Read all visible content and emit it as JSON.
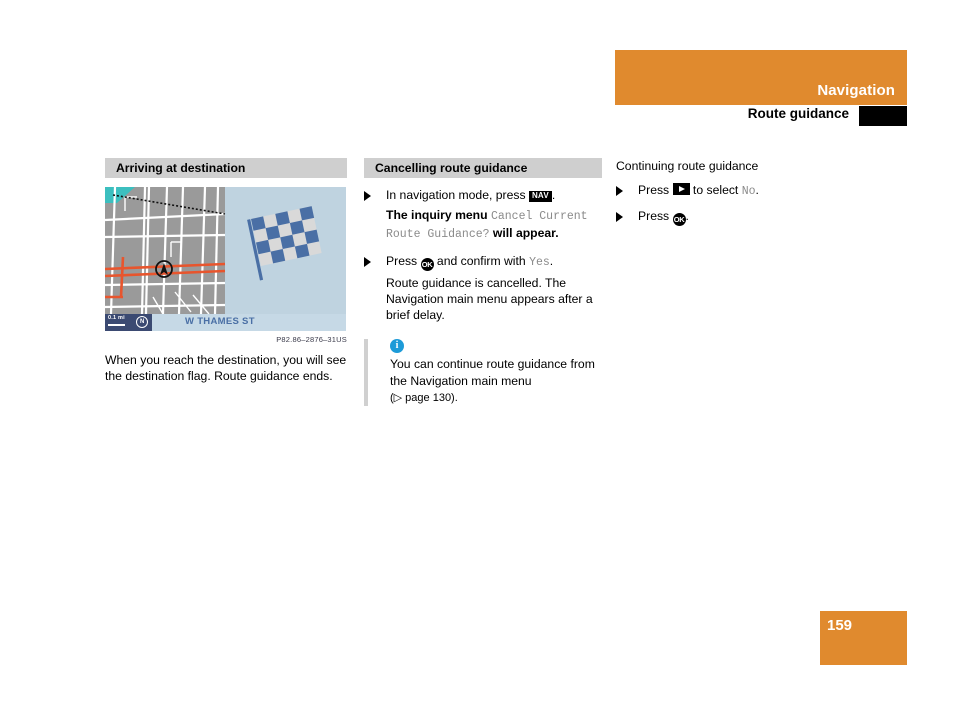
{
  "header": {
    "title": "Navigation",
    "subtitle": "Route guidance",
    "band_color": "#e08a2e",
    "block_color": "#000000"
  },
  "left_column": {
    "heading": "Arriving at destination",
    "figure": {
      "street_name": "W THAMES ST",
      "scale_label": "0.1 mi",
      "compass_glyph": "N",
      "reference": "P82.86–2876–31US"
    },
    "body": "When you reach the destination, you will see the destination flag. Route guidance ends."
  },
  "middle_column": {
    "heading": "Cancelling route guidance",
    "steps": [
      {
        "prefix": "In navigation mode, press ",
        "key": "NAV",
        "suffix": "."
      }
    ],
    "result_1": {
      "lead": "The inquiry menu ",
      "mono": "Cancel Current Route Guidance?",
      "tail": " will appear."
    },
    "step_2": {
      "prefix": "Press ",
      "key": "OK",
      "middle": " and confirm with ",
      "mono": "Yes",
      "suffix": "."
    },
    "result_2": "Route guidance is cancelled. The Navigation main menu appears after a brief delay.",
    "note": {
      "icon": "i",
      "line_1": "You can continue route guidance from",
      "line_2": "the Navigation main menu",
      "line_3": "(▷ page 130)."
    }
  },
  "right_column": {
    "heading": "Continuing route guidance",
    "step_1": {
      "prefix": "Press ",
      "key": "right-arrow",
      "middle": " to select ",
      "mono": "No",
      "suffix": "."
    },
    "step_2": {
      "prefix": "Press ",
      "key": "OK",
      "suffix": "."
    }
  },
  "footer": {
    "page_number": "159",
    "block_color": "#e08a2e"
  }
}
